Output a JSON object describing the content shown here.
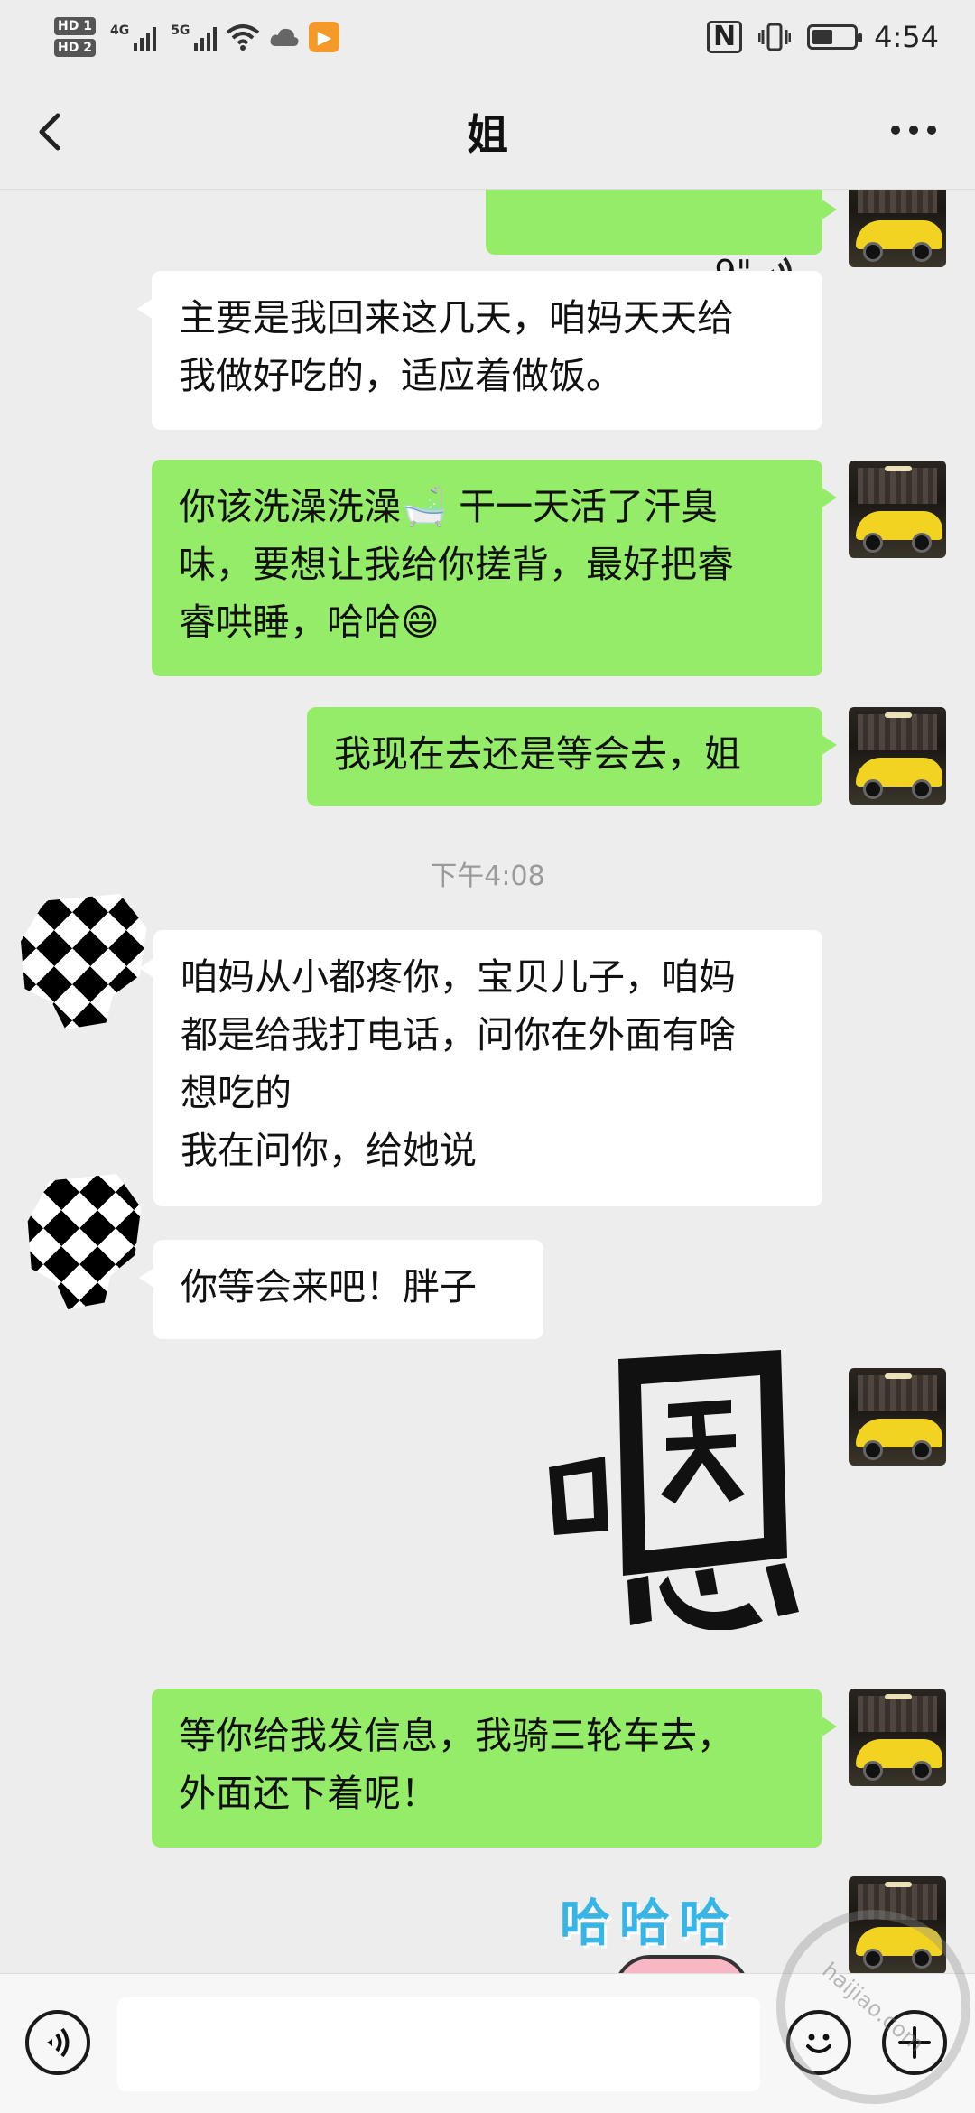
{
  "status_bar": {
    "hd1": "HD 1",
    "hd2": "HD 2",
    "net1": "4G",
    "net2": "5G",
    "app_badge": "▶",
    "nfc": "N",
    "time": "4:54"
  },
  "nav": {
    "back_icon": "chevron-left-icon",
    "title": "姐",
    "more_icon": "more-dots-icon"
  },
  "messages": [
    {
      "side": "me",
      "type": "voice",
      "duration": "9\""
    },
    {
      "side": "other",
      "type": "text",
      "text": "主要是我回来这几天，咱妈天天给\n我做好吃的，适应着做饭。"
    },
    {
      "side": "me",
      "type": "text",
      "text": "你该洗澡洗澡🛁 干一天活了汗臭\n味，要想让我给你搓背，最好把睿\n睿哄睡，哈哈😄"
    },
    {
      "side": "me",
      "type": "text",
      "text": "我现在去还是等会去，姐"
    },
    {
      "type": "timestamp",
      "text": "下午4:08"
    },
    {
      "side": "other",
      "type": "text",
      "text": "咱妈从小都疼你，宝贝儿子，咱妈\n都是给我打电话，问你在外面有啥\n想吃的\n我在问你，给她说"
    },
    {
      "side": "other",
      "type": "text",
      "text": "你等会来吧！胖子"
    },
    {
      "side": "me",
      "type": "sticker",
      "text": "嗯"
    },
    {
      "side": "me",
      "type": "text",
      "text": "等你给我发信息，我骑三轮车去，\n外面还下着呢！"
    },
    {
      "side": "me",
      "type": "sticker",
      "text": "哈哈哈"
    }
  ],
  "input_bar": {
    "voice_icon": "voice-input-icon",
    "emoji_icon": "emoji-icon",
    "plus_icon": "plus-icon",
    "placeholder": ""
  },
  "watermark": "haijiao.com",
  "colors": {
    "background": "#ededed",
    "my_bubble": "#95ec69",
    "their_bubble": "#ffffff"
  }
}
